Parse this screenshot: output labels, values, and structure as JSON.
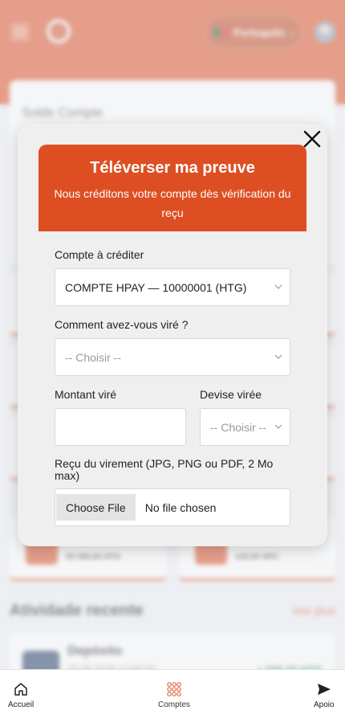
{
  "header": {
    "language": "Português",
    "icons": [
      "menu-icon",
      "logo",
      "chevron-down-icon",
      "user-avatar"
    ]
  },
  "background": {
    "balance_title": "Solde Compte",
    "cards": [
      {
        "amount": "25 000,00 HTG"
      },
      {
        "amount": "120,00 HPC"
      }
    ],
    "activity": {
      "title": "Atividade recente",
      "see_more": "Voir plus",
      "item": {
        "title": "Depósito",
        "date": "20.09.2026 10:00:00",
        "amount": "+ 000,00 HTG"
      }
    }
  },
  "modal": {
    "title": "Téléverser ma preuve",
    "subtitle": "Nous créditons votre compte dès vérification du reçu",
    "account_label": "Compte à créditer",
    "account_value": "COMPTE HPAY — 10000001 (HTG)",
    "method_label": "Comment avez-vous viré ?",
    "method_placeholder": "-- Choisir --",
    "amount_label": "Montant viré",
    "amount_value": "",
    "currency_label": "Devise virée",
    "currency_placeholder": "-- Choisir --",
    "receipt_label": "Reçu du virement (JPG, PNG ou PDF, 2 Mo max)",
    "file_button": "Choose File",
    "file_status": "No file chosen"
  },
  "bottom_nav": [
    {
      "label": "Accueil",
      "icon": "home-icon"
    },
    {
      "label": "Comptes",
      "icon": "grid-icon"
    },
    {
      "label": "Apoio",
      "icon": "send-icon"
    }
  ],
  "colors": {
    "accent": "#dd4f22",
    "positive": "#1c8a3a"
  }
}
